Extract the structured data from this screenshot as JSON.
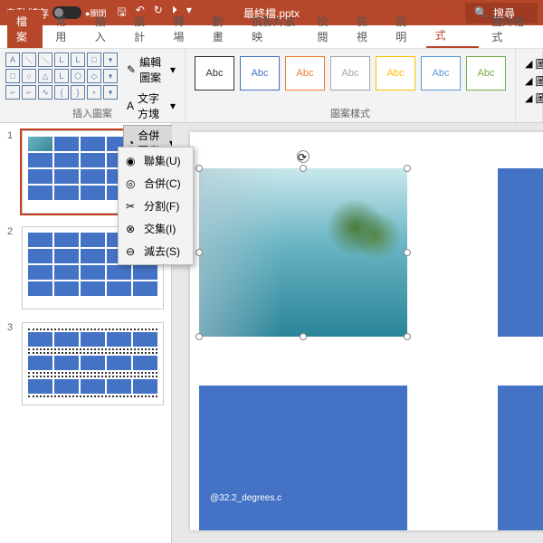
{
  "titlebar": {
    "autosave_label": "自動儲存",
    "autosave_state": "●關閉",
    "filename": "最終檔.pptx",
    "search_label": "搜尋"
  },
  "tabs": {
    "file": "檔案",
    "home": "常用",
    "insert": "插入",
    "design": "設計",
    "transitions": "轉場",
    "animations": "動畫",
    "slideshow": "投影片放映",
    "review": "校閱",
    "view": "檢視",
    "help": "說明",
    "shape_format": "圖形格式",
    "picture_format": "圖片格式"
  },
  "ribbon": {
    "insert_shapes_label": "插入圖案",
    "edit_shape": "編輯圖案",
    "text_box": "文字方塊",
    "merge_shapes": "合併圖案",
    "shape_styles_label": "圖案樣式",
    "abc": "Abc",
    "shape_fill": "圖",
    "shape_outline": "圖",
    "shape_effects": "圖"
  },
  "merge_menu": {
    "union": "聯集(U)",
    "combine": "合併(C)",
    "fragment": "分割(F)",
    "intersect": "交集(I)",
    "subtract": "減去(S)"
  },
  "thumbnails": [
    "1",
    "2",
    "3"
  ],
  "slide": {
    "caption": "@32.2_degrees.c"
  }
}
